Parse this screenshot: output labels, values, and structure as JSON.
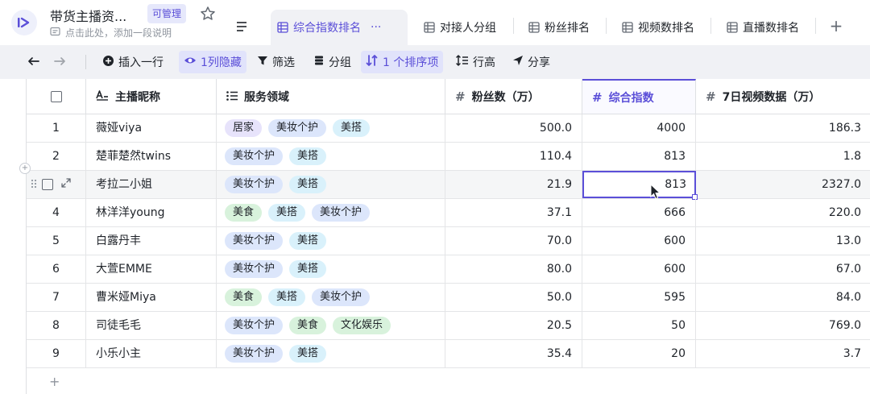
{
  "app": {
    "title": "带货主播资...",
    "permission_badge": "可管理",
    "description_placeholder": "点击此处，添加一段说明",
    "accent_color": "#5b4fd8"
  },
  "tabs": [
    {
      "label": "综合指数排名",
      "icon": "table-icon",
      "active": true,
      "more": "···"
    },
    {
      "label": "对接人分组",
      "icon": "table-icon",
      "active": false
    },
    {
      "label": "粉丝排名",
      "icon": "table-icon",
      "active": false
    },
    {
      "label": "视频数排名",
      "icon": "table-icon",
      "active": false
    },
    {
      "label": "直播数排名",
      "icon": "table-icon",
      "active": false
    }
  ],
  "add_tab_label": "+",
  "toolbar": {
    "undo_icon": "undo-icon",
    "redo_icon": "redo-icon",
    "insert_row": "插入一行",
    "hidden_cols": "1列隐藏",
    "filter": "筛选",
    "group": "分组",
    "sort": "1 个排序项",
    "row_height": "行高",
    "share": "分享"
  },
  "columns": [
    {
      "label": "主播昵称",
      "icon": "text-field-icon"
    },
    {
      "label": "服务领域",
      "icon": "multi-select-icon"
    },
    {
      "label": "粉丝数（万）",
      "icon": "#"
    },
    {
      "label": "综合指数",
      "icon": "#"
    },
    {
      "label": "7日视频数据（万）",
      "icon": "#"
    }
  ],
  "tag_colors": {
    "居家": "#e7e3fb",
    "美妆个护": "#dce6fb",
    "美搭": "#d9f1fb",
    "美食": "#d8f2dc",
    "文化娱乐": "#d8f2dc"
  },
  "rows": [
    {
      "idx": "1",
      "name": "薇娅viya",
      "tags": [
        "居家",
        "美妆个护",
        "美搭"
      ],
      "fans": "500.0",
      "score": "4000",
      "video": "186.3"
    },
    {
      "idx": "2",
      "name": "楚菲楚然twins",
      "tags": [
        "美妆个护",
        "美搭"
      ],
      "fans": "110.4",
      "score": "813",
      "video": "1.8"
    },
    {
      "idx": "",
      "name": "考拉二小姐",
      "tags": [
        "美妆个护",
        "美搭"
      ],
      "fans": "21.9",
      "score": "813",
      "video": "2327.0"
    },
    {
      "idx": "4",
      "name": "林洋洋young",
      "tags": [
        "美食",
        "美搭",
        "美妆个护"
      ],
      "fans": "37.1",
      "score": "666",
      "video": "220.0"
    },
    {
      "idx": "5",
      "name": "白露丹丰",
      "tags": [
        "美妆个护",
        "美搭"
      ],
      "fans": "70.0",
      "score": "600",
      "video": "13.0"
    },
    {
      "idx": "6",
      "name": "大萱EMME",
      "tags": [
        "美妆个护",
        "美搭"
      ],
      "fans": "80.0",
      "score": "600",
      "video": "67.0"
    },
    {
      "idx": "7",
      "name": "曹米娅Miya",
      "tags": [
        "美食",
        "美搭",
        "美妆个护"
      ],
      "fans": "50.0",
      "score": "595",
      "video": "84.0"
    },
    {
      "idx": "8",
      "name": "司徒毛毛",
      "tags": [
        "美妆个护",
        "美食",
        "文化娱乐"
      ],
      "fans": "20.5",
      "score": "50",
      "video": "769.0"
    },
    {
      "idx": "9",
      "name": "小乐小主",
      "tags": [
        "美妆个护",
        "美搭"
      ],
      "fans": "35.4",
      "score": "20",
      "video": "3.7"
    }
  ],
  "add_row_label": "+"
}
